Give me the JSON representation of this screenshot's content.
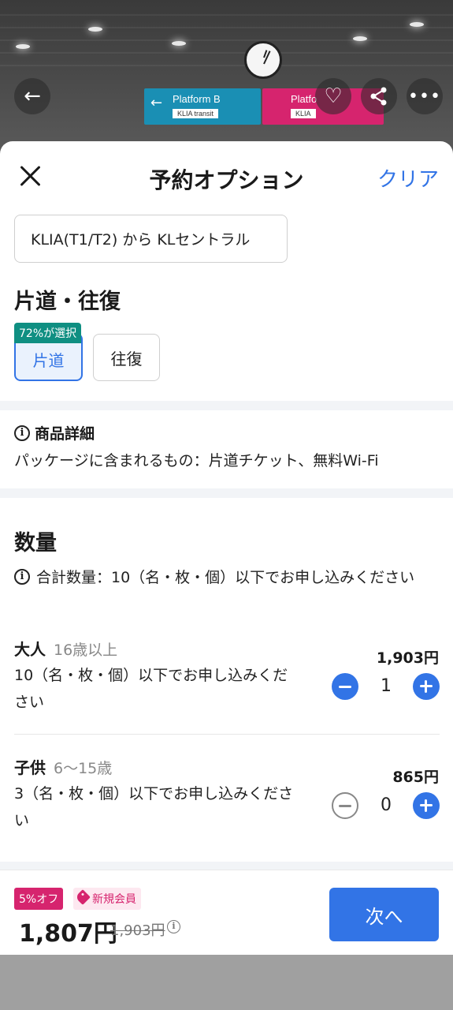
{
  "hero": {
    "sign_b_title": "Platform B",
    "sign_b_sub": "KLIA transit",
    "sign_c_title": "Platfo",
    "sign_c_sub": "KLIA"
  },
  "top_actions": {
    "back_icon": "arrow-left-icon",
    "favorite_icon": "heart-icon",
    "share_icon": "share-icon",
    "more_icon": "more-icon"
  },
  "header": {
    "title": "予約オプション",
    "clear_label": "クリア"
  },
  "route": {
    "value": "KLIA(T1/T2) から KLセントラル"
  },
  "trip_type": {
    "title": "片道・往復",
    "badge": "72%が選択",
    "options": [
      {
        "label": "片道",
        "selected": true
      },
      {
        "label": "往復",
        "selected": false
      }
    ]
  },
  "details": {
    "title": "商品詳細",
    "body": "パッケージに含まれるもの：片道チケット、無料Wi-Fi"
  },
  "quantity": {
    "title": "数量",
    "note": "合計数量：10（名・枚・個）以下でお申し込みください",
    "rows": [
      {
        "label": "大人",
        "sub": "16歳以上",
        "desc": "10（名・枚・個）以下でお申し込みください",
        "price": "1,903円",
        "value": "1",
        "minus_enabled": true
      },
      {
        "label": "子供",
        "sub": "6〜15歳",
        "desc": "3（名・枚・個）以下でお申し込みください",
        "price": "865円",
        "value": "0",
        "minus_enabled": false
      }
    ]
  },
  "footer": {
    "discount_badge": "5%オフ",
    "member_badge": "新規会員",
    "total": "1,807円",
    "original": "1,903円",
    "next_label": "次へ"
  },
  "colors": {
    "accent": "#3274e6",
    "badge_teal": "#0f8f82",
    "discount_pink": "#d6246e"
  }
}
